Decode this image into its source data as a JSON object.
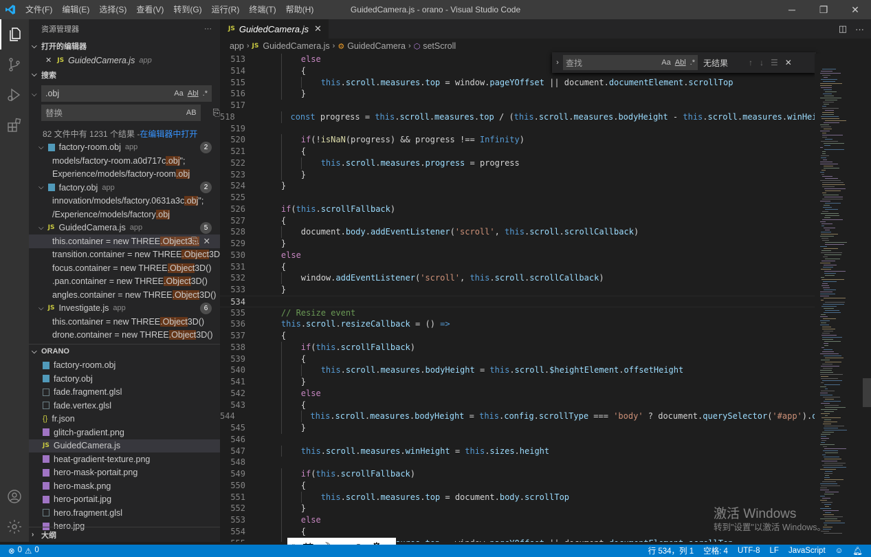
{
  "titlebar": {
    "menus": [
      "文件(F)",
      "编辑(E)",
      "选择(S)",
      "查看(V)",
      "转到(G)",
      "运行(R)",
      "终端(T)",
      "帮助(H)"
    ],
    "title": "GuidedCamera.js - orano - Visual Studio Code",
    "minimize": "─",
    "maximize": "❐",
    "close": "✕"
  },
  "sidebar": {
    "title": "资源管理器",
    "more": "···",
    "open_editors": {
      "label": "打开的编辑器",
      "file": "GuidedCamera.js",
      "folder": "app",
      "js_badge": "JS",
      "close": "✕"
    },
    "search": {
      "label": "搜索",
      "query": ".obj",
      "replace_placeholder": "替换",
      "opt_case": "Aa",
      "opt_word": "Abl",
      "opt_regex": ".*",
      "opt_preserve": "AB",
      "summary": "82 文件中有 1231 个结果 - ",
      "summary_link": "在编辑器中打开"
    },
    "results": {
      "r0_name": "factory-room.obj",
      "r0_folder": "app",
      "r0_count": "2",
      "r1_pre": "models/factory-room.a0d717c",
      "r1_hl": ".obj",
      "r1_post": "\";",
      "r2_pre": "Experience/models/factory-room",
      "r2_hl": ".obj",
      "r3_name": "factory.obj",
      "r3_folder": "app",
      "r3_count": "2",
      "r4_pre": "innovation/models/factory.0631a3c",
      "r4_hl": ".obj",
      "r4_post": "\";",
      "r5_pre": "/Experience/models/factory",
      "r5_hl": ".obj",
      "r6_name": "GuidedCamera.js",
      "r6_folder": "app",
      "r6_count": "5",
      "r7_pre": "this.container = new THREE",
      "r7_hl": ".Object3...",
      "r8_pre": "transition.container = new THREE",
      "r8_hl": ".Object",
      "r8_post": "3D()",
      "r9_pre": "focus.container = new THREE",
      "r9_hl": ".Object",
      "r9_post": "3D()",
      "r10_pre": ".pan.container = new THREE",
      "r10_hl": ".Object",
      "r10_post": "3D()",
      "r11_pre": "angles.container = new THREE",
      "r11_hl": ".Object",
      "r11_post": "3D()",
      "r12_name": "Investigate.js",
      "r12_folder": "app",
      "r12_count": "6",
      "r13_pre": "this.container = new THREE",
      "r13_hl": ".Object",
      "r13_post": "3D()",
      "r14_pre": "drone.container = new THREE",
      "r14_hl": ".Object",
      "r14_post": "3D()"
    },
    "folder": {
      "label": "ORANO",
      "files": [
        "factory-room.obj",
        "factory.obj",
        "fade.fragment.glsl",
        "fade.vertex.glsl",
        "fr.json",
        "glitch-gradient.png",
        "GuidedCamera.js",
        "heat-gradient-texture.png",
        "hero-mask-portait.png",
        "hero-mask.png",
        "hero-portait.jpg",
        "hero.fragment.glsl",
        "hero.jpg"
      ]
    },
    "outline": "大纲"
  },
  "editor": {
    "tab_label": "GuidedCamera.js",
    "tab_js": "JS",
    "tab_close": "✕",
    "breadcrumb": [
      "app",
      "GuidedCamera.js",
      "GuidedCamera",
      "setScroll"
    ],
    "find": {
      "placeholder": "查找",
      "result": "无结果",
      "opt_case": "Aa",
      "opt_word": "Abl",
      "opt_regex": ".*"
    },
    "lines": [
      {
        "n": "513",
        "t": "        else"
      },
      {
        "n": "514",
        "t": "        {"
      },
      {
        "n": "515",
        "t": "            this.scroll.measures.top = window.pageYOffset || document.documentElement.scrollTop"
      },
      {
        "n": "516",
        "t": "        }"
      },
      {
        "n": "517",
        "t": ""
      },
      {
        "n": "518",
        "t": "        const progress = this.scroll.measures.top / (this.scroll.measures.bodyHeight - this.scroll.measures.winHeig"
      },
      {
        "n": "519",
        "t": ""
      },
      {
        "n": "520",
        "t": "        if(!isNaN(progress) && progress !== Infinity)"
      },
      {
        "n": "521",
        "t": "        {"
      },
      {
        "n": "522",
        "t": "            this.scroll.measures.progress = progress"
      },
      {
        "n": "523",
        "t": "        }"
      },
      {
        "n": "524",
        "t": "    }"
      },
      {
        "n": "525",
        "t": ""
      },
      {
        "n": "526",
        "t": "    if(this.scrollFallback)"
      },
      {
        "n": "527",
        "t": "    {"
      },
      {
        "n": "528",
        "t": "        document.body.addEventListener('scroll', this.scroll.scrollCallback)"
      },
      {
        "n": "529",
        "t": "    }"
      },
      {
        "n": "530",
        "t": "    else"
      },
      {
        "n": "531",
        "t": "    {"
      },
      {
        "n": "532",
        "t": "        window.addEventListener('scroll', this.scroll.scrollCallback)"
      },
      {
        "n": "533",
        "t": "    }"
      },
      {
        "n": "534",
        "t": ""
      },
      {
        "n": "535",
        "t": "    // Resize event"
      },
      {
        "n": "536",
        "t": "    this.scroll.resizeCallback = () =>"
      },
      {
        "n": "537",
        "t": "    {"
      },
      {
        "n": "538",
        "t": "        if(this.scrollFallback)"
      },
      {
        "n": "539",
        "t": "        {"
      },
      {
        "n": "540",
        "t": "            this.scroll.measures.bodyHeight = this.scroll.$heightElement.offsetHeight"
      },
      {
        "n": "541",
        "t": "        }"
      },
      {
        "n": "542",
        "t": "        else"
      },
      {
        "n": "543",
        "t": "        {"
      },
      {
        "n": "544",
        "t": "            this.scroll.measures.bodyHeight = this.config.scrollType === 'body' ? document.querySelector('#app').of"
      },
      {
        "n": "545",
        "t": "        }"
      },
      {
        "n": "546",
        "t": ""
      },
      {
        "n": "547",
        "t": "        this.scroll.measures.winHeight = this.sizes.height"
      },
      {
        "n": "548",
        "t": ""
      },
      {
        "n": "549",
        "t": "        if(this.scrollFallback)"
      },
      {
        "n": "550",
        "t": "        {"
      },
      {
        "n": "551",
        "t": "            this.scroll.measures.top = document.body.scrollTop"
      },
      {
        "n": "552",
        "t": "        }"
      },
      {
        "n": "553",
        "t": "        else"
      },
      {
        "n": "554",
        "t": "        {"
      },
      {
        "n": "555",
        "t": "            this.scroll.measures.top = window.pageYOffset || document.documentElement.scrollTop"
      }
    ]
  },
  "watermark": {
    "line1": "激活 Windows",
    "line2": "转到\"设置\"以激活 Windows。"
  },
  "ime": {
    "lang": "英",
    "moon": "☽",
    "punct": "•,",
    "emoji": "☺",
    "settings": "⚙"
  },
  "statusbar": {
    "errors": "0",
    "warnings": "0",
    "position": "行 534，列 1",
    "spaces": "空格: 4",
    "encoding": "UTF-8",
    "eol": "LF",
    "language": "JavaScript"
  },
  "colors": {
    "accent": "#007acc",
    "match_highlight": "#ea5c00"
  }
}
